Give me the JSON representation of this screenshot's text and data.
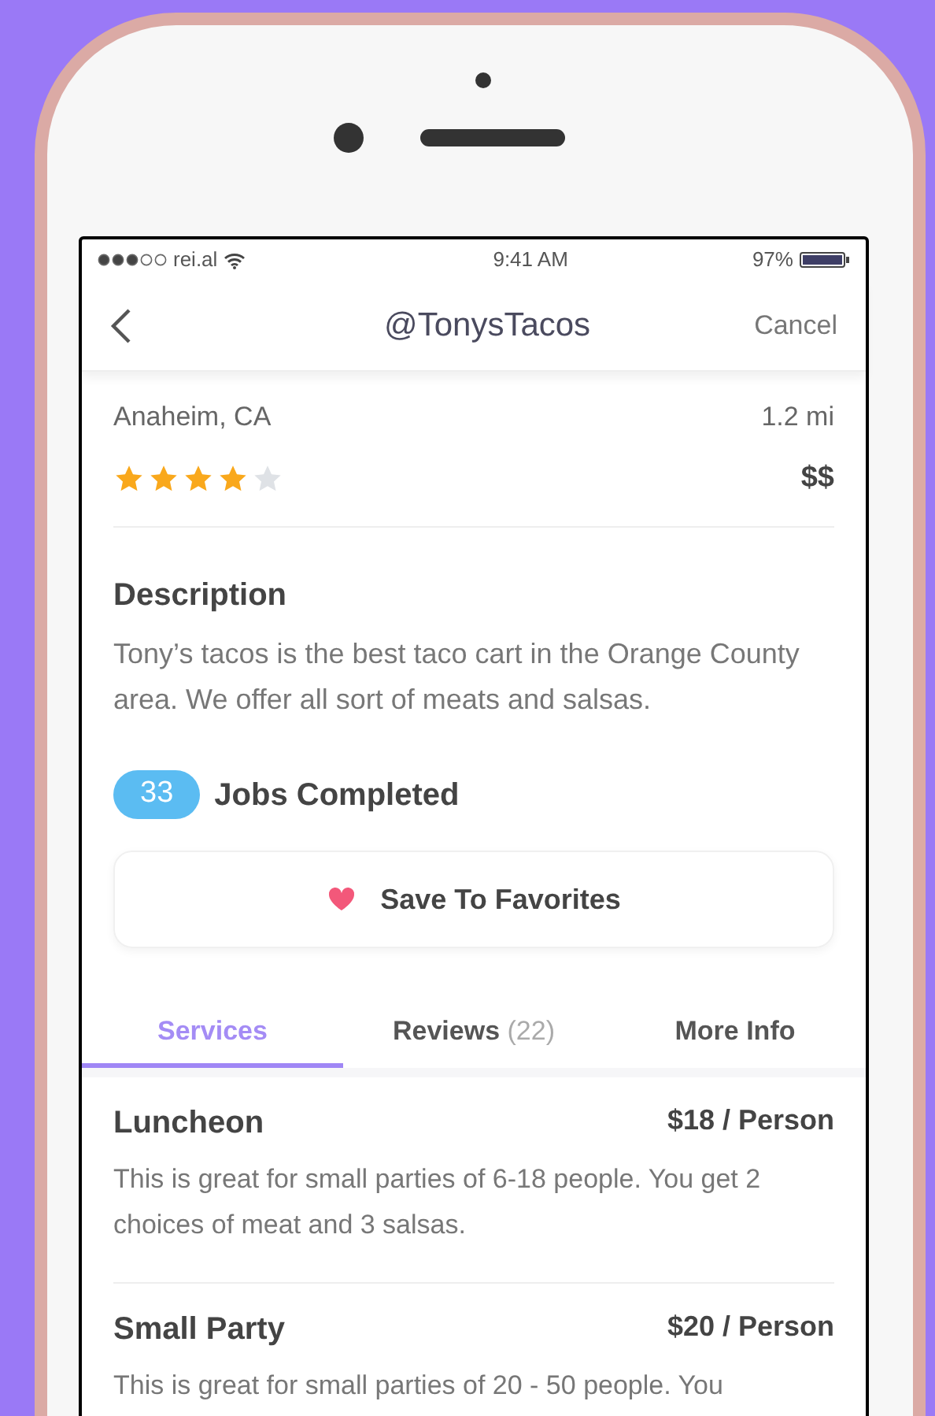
{
  "status_bar": {
    "carrier": "rei.al",
    "time": "9:41 AM",
    "battery": "97%"
  },
  "nav": {
    "title": "@TonysTacos",
    "action": "Cancel"
  },
  "vendor": {
    "location": "Anaheim, CA",
    "distance": "1.2 mi",
    "stars": 4,
    "price": "$$"
  },
  "description": {
    "heading": "Description",
    "text": "Tony’s tacos is the best taco cart in the Orange County area. We offer all sort of meats and salsas."
  },
  "jobs": {
    "count": "33",
    "label": "Jobs Completed"
  },
  "favorite_button": {
    "label": "Save To Favorites"
  },
  "tabs": [
    {
      "label": "Services",
      "selected": true
    },
    {
      "label": "Reviews",
      "count": "(22)",
      "selected": false
    },
    {
      "label": "More Info",
      "selected": false
    }
  ],
  "services": [
    {
      "name": "Luncheon",
      "price": "$18 / Person",
      "text": "This is great for small parties of 6-18 people. You get 2 choices of meat and 3 salsas."
    },
    {
      "name": "Small Party",
      "price": "$20 / Person",
      "text": "This is great for small parties of 20 - 50 people. You"
    }
  ]
}
